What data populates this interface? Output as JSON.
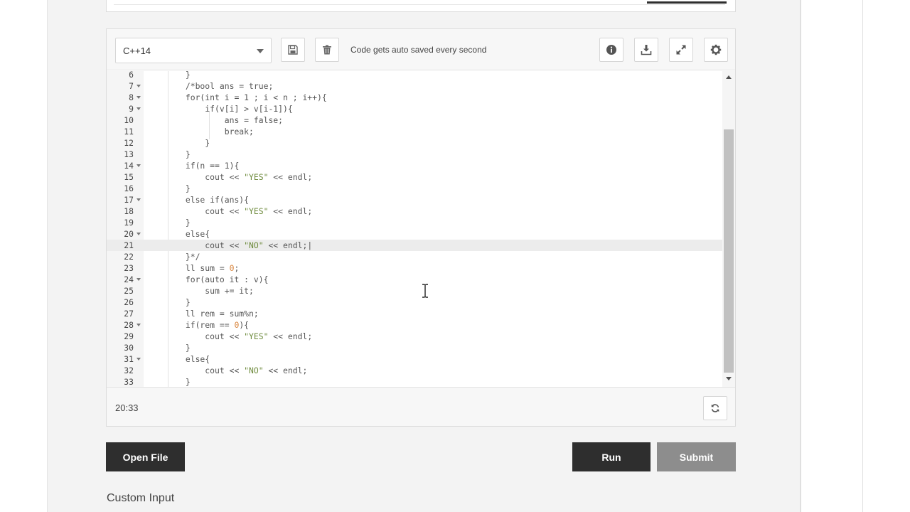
{
  "toolbar": {
    "language": "C++14",
    "autosave_text": "Code gets auto saved every second",
    "icons": [
      "save-icon",
      "trash-icon",
      "info-icon",
      "download-icon",
      "fullscreen-icon",
      "gear-icon"
    ]
  },
  "editor": {
    "active_line": 21,
    "lines": [
      {
        "n": "6",
        "fold": false,
        "text": "        }"
      },
      {
        "n": "7",
        "fold": true,
        "text": "        /*bool ans = true;"
      },
      {
        "n": "8",
        "fold": true,
        "text": "        for(int i = 1 ; i < n ; i++){"
      },
      {
        "n": "9",
        "fold": true,
        "text": "            if(v[i] > v[i-1]){"
      },
      {
        "n": "10",
        "fold": false,
        "text": "                ans = false;"
      },
      {
        "n": "11",
        "fold": false,
        "text": "                break;"
      },
      {
        "n": "12",
        "fold": false,
        "text": "            }"
      },
      {
        "n": "13",
        "fold": false,
        "text": "        }"
      },
      {
        "n": "14",
        "fold": true,
        "text": "        if(n == 1){"
      },
      {
        "n": "15",
        "fold": false,
        "text": "            cout << \"YES\" << endl;"
      },
      {
        "n": "16",
        "fold": false,
        "text": "        }"
      },
      {
        "n": "17",
        "fold": true,
        "text": "        else if(ans){"
      },
      {
        "n": "18",
        "fold": false,
        "text": "            cout << \"YES\" << endl;"
      },
      {
        "n": "19",
        "fold": false,
        "text": "        }"
      },
      {
        "n": "20",
        "fold": true,
        "text": "        else{"
      },
      {
        "n": "21",
        "fold": false,
        "text": "            cout << \"NO\" << endl;|"
      },
      {
        "n": "22",
        "fold": false,
        "text": "        }*/"
      },
      {
        "n": "23",
        "fold": false,
        "text": "        ll sum = 0;"
      },
      {
        "n": "24",
        "fold": true,
        "text": "        for(auto it : v){"
      },
      {
        "n": "25",
        "fold": false,
        "text": "            sum += it;"
      },
      {
        "n": "26",
        "fold": false,
        "text": "        }"
      },
      {
        "n": "27",
        "fold": false,
        "text": "        ll rem = sum%n;"
      },
      {
        "n": "28",
        "fold": true,
        "text": "        if(rem == 0){"
      },
      {
        "n": "29",
        "fold": false,
        "text": "            cout << \"YES\" << endl;"
      },
      {
        "n": "30",
        "fold": false,
        "text": "        }"
      },
      {
        "n": "31",
        "fold": true,
        "text": "        else{"
      },
      {
        "n": "32",
        "fold": false,
        "text": "            cout << \"NO\" << endl;"
      },
      {
        "n": "33",
        "fold": false,
        "text": "        }"
      }
    ]
  },
  "footer": {
    "timer": "20:33"
  },
  "actions": {
    "open_file": "Open File",
    "run": "Run",
    "submit": "Submit"
  },
  "custom_input_label": "Custom Input"
}
